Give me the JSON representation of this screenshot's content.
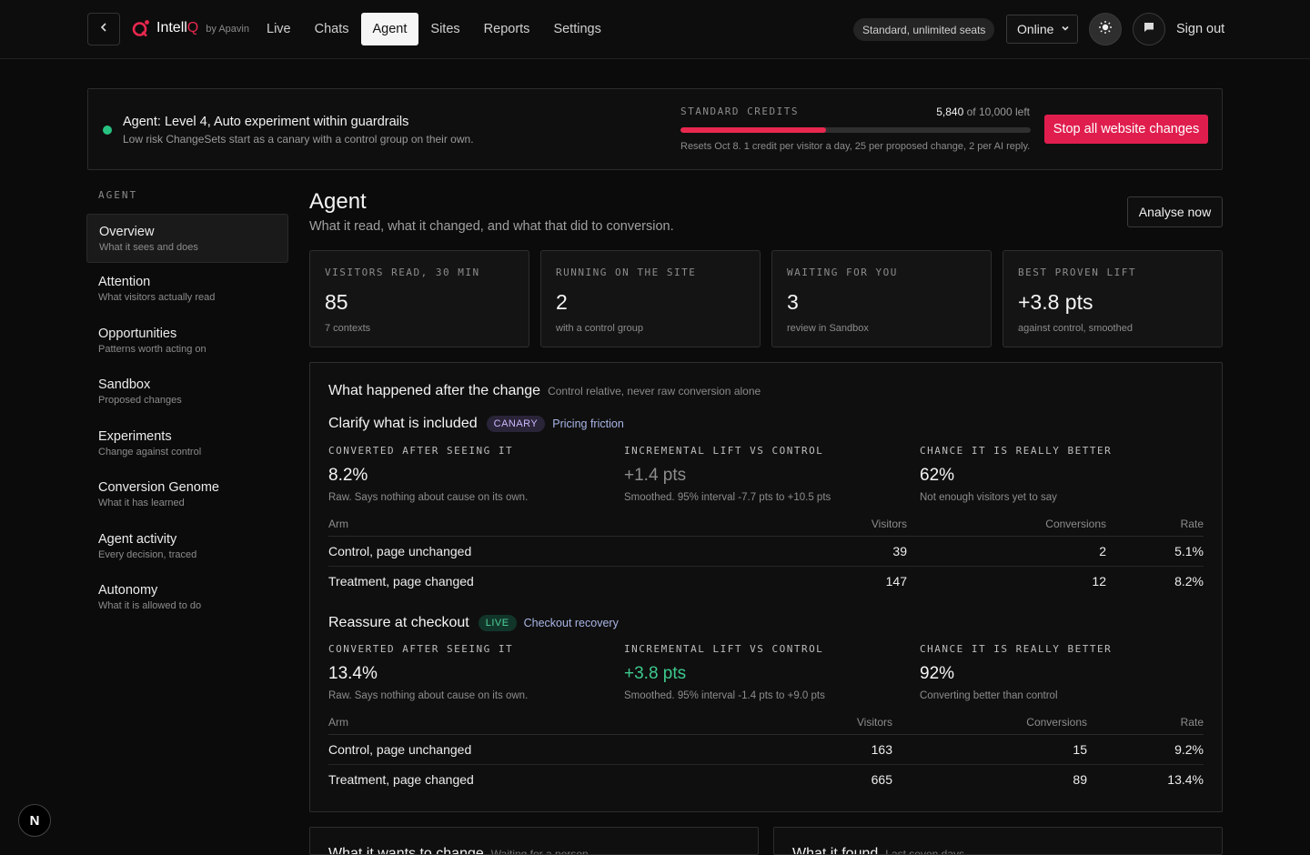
{
  "header": {
    "brand_prefix": "Intell",
    "brand_suffix": "Q",
    "brand_by": "by Apavin",
    "nav": [
      {
        "label": "Live",
        "active": false
      },
      {
        "label": "Chats",
        "active": false
      },
      {
        "label": "Agent",
        "active": true
      },
      {
        "label": "Sites",
        "active": false
      },
      {
        "label": "Reports",
        "active": false
      },
      {
        "label": "Settings",
        "active": false
      }
    ],
    "plan": "Standard, unlimited seats",
    "status": "Online",
    "sign_out": "Sign out"
  },
  "banner": {
    "title": "Agent: Level 4, Auto experiment within guardrails",
    "subtitle": "Low risk ChangeSets start as a canary with a control group on their own.",
    "credits_label": "STANDARD CREDITS",
    "credits_remaining": "5,840",
    "credits_of": "of 10,000 left",
    "credits_fraction_used": 0.416,
    "credits_note": "Resets Oct 8. 1 credit per visitor a day, 25 per proposed change, 2 per AI reply.",
    "stop_button": "Stop all website changes",
    "accent_color": "#e01e4e",
    "status_dot_color": "#27c281"
  },
  "sidebar": {
    "heading": "AGENT",
    "items": [
      {
        "title": "Overview",
        "sub": "What it sees and does",
        "active": true
      },
      {
        "title": "Attention",
        "sub": "What visitors actually read"
      },
      {
        "title": "Opportunities",
        "sub": "Patterns worth acting on"
      },
      {
        "title": "Sandbox",
        "sub": "Proposed changes"
      },
      {
        "title": "Experiments",
        "sub": "Change against control"
      },
      {
        "title": "Conversion Genome",
        "sub": "What it has learned"
      },
      {
        "title": "Agent activity",
        "sub": "Every decision, traced"
      },
      {
        "title": "Autonomy",
        "sub": "What it is allowed to do"
      }
    ]
  },
  "main": {
    "title": "Agent",
    "subtitle": "What it read, what it changed, and what that did to conversion.",
    "analyse_button": "Analyse now",
    "stats": [
      {
        "label": "VISITORS READ, 30 MIN",
        "value": "85",
        "hint": "7 contexts"
      },
      {
        "label": "RUNNING ON THE SITE",
        "value": "2",
        "hint": "with a control group"
      },
      {
        "label": "WAITING FOR YOU",
        "value": "3",
        "hint": "review in Sandbox"
      },
      {
        "label": "BEST PROVEN LIFT",
        "value": "+3.8 pts",
        "hint": "against control, smoothed"
      }
    ],
    "panel": {
      "title": "What happened after the change",
      "note": "Control relative, never raw conversion alone",
      "experiments": [
        {
          "name": "Clarify what is included",
          "badge": "CANARY",
          "category": "Pricing friction",
          "metrics": [
            {
              "label": "CONVERTED AFTER SEEING IT",
              "value": "8.2%",
              "hint": "Raw. Says nothing about cause on its own."
            },
            {
              "label": "INCREMENTAL LIFT VS CONTROL",
              "value": "+1.4 pts",
              "hint": "Smoothed. 95% interval -7.7 pts to +10.5 pts"
            },
            {
              "label": "CHANCE IT IS REALLY BETTER",
              "value": "62%",
              "hint": "Not enough visitors yet to say"
            }
          ],
          "table": {
            "headers": [
              "Arm",
              "Visitors",
              "Conversions",
              "Rate"
            ],
            "rows": [
              [
                "Control, page unchanged",
                "39",
                "2",
                "5.1%"
              ],
              [
                "Treatment, page changed",
                "147",
                "12",
                "8.2%"
              ]
            ]
          }
        },
        {
          "name": "Reassure at checkout",
          "badge": "LIVE",
          "category": "Checkout recovery",
          "metrics": [
            {
              "label": "CONVERTED AFTER SEEING IT",
              "value": "13.4%",
              "hint": "Raw. Says nothing about cause on its own."
            },
            {
              "label": "INCREMENTAL LIFT VS CONTROL",
              "value": "+3.8 pts",
              "hint": "Smoothed. 95% interval -1.4 pts to +9.0 pts"
            },
            {
              "label": "CHANCE IT IS REALLY BETTER",
              "value": "92%",
              "hint": "Converting better than control"
            }
          ],
          "table": {
            "headers": [
              "Arm",
              "Visitors",
              "Conversions",
              "Rate"
            ],
            "rows": [
              [
                "Control, page unchanged",
                "163",
                "15",
                "9.2%"
              ],
              [
                "Treatment, page changed",
                "665",
                "89",
                "13.4%"
              ]
            ]
          }
        }
      ]
    },
    "bottom_cards": [
      {
        "title": "What it wants to change",
        "note": "Waiting for a person"
      },
      {
        "title": "What it found",
        "note": "Last seven days"
      }
    ]
  },
  "floating_badge": "N"
}
